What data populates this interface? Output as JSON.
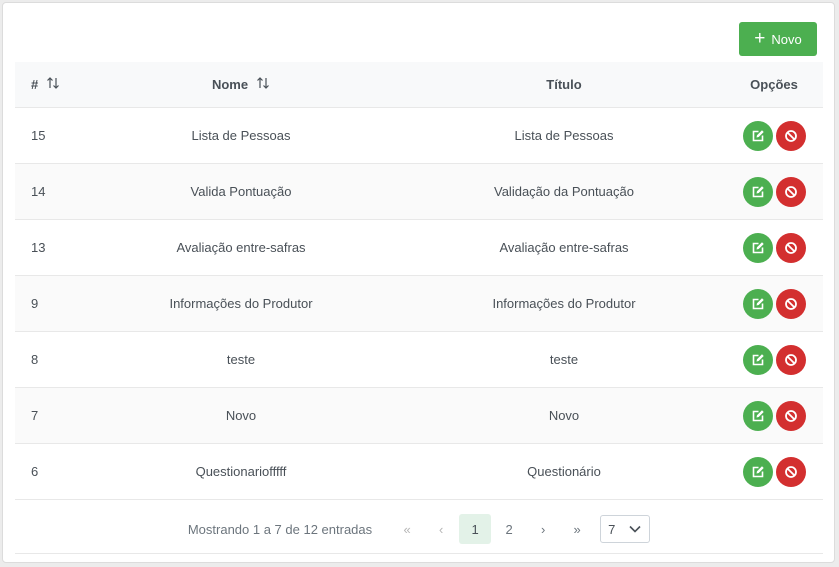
{
  "toolbar": {
    "new_label": "Novo"
  },
  "table": {
    "headers": {
      "id": "#",
      "name": "Nome",
      "title": "Título",
      "options": "Opções"
    },
    "rows": [
      {
        "id": "15",
        "name": "Lista de Pessoas",
        "title": "Lista de Pessoas"
      },
      {
        "id": "14",
        "name": "Valida Pontuação",
        "title": "Validação da Pontuação"
      },
      {
        "id": "13",
        "name": "Avaliação entre-safras",
        "title": "Avaliação entre-safras"
      },
      {
        "id": "9",
        "name": "Informações do Produtor",
        "title": "Informações do Produtor"
      },
      {
        "id": "8",
        "name": "teste",
        "title": "teste"
      },
      {
        "id": "7",
        "name": "Novo",
        "title": "Novo"
      },
      {
        "id": "6",
        "name": "Questionariofffff",
        "title": "Questionário"
      }
    ]
  },
  "pagination": {
    "info": "Mostrando 1 a 7 de 12 entradas",
    "first_icon": "«",
    "prev_icon": "‹",
    "pages": [
      "1",
      "2"
    ],
    "current_page": "1",
    "next_icon": "›",
    "last_icon": "»",
    "rows_per_page": "7"
  },
  "colors": {
    "success": "#4caf50",
    "danger": "#d32f2f",
    "header_bg": "#f8f9fa"
  },
  "icons": {
    "new": "plus-icon",
    "edit": "edit-icon",
    "delete": "ban-icon",
    "sort": "sort-icon",
    "dropdown": "chevron-down-icon"
  }
}
